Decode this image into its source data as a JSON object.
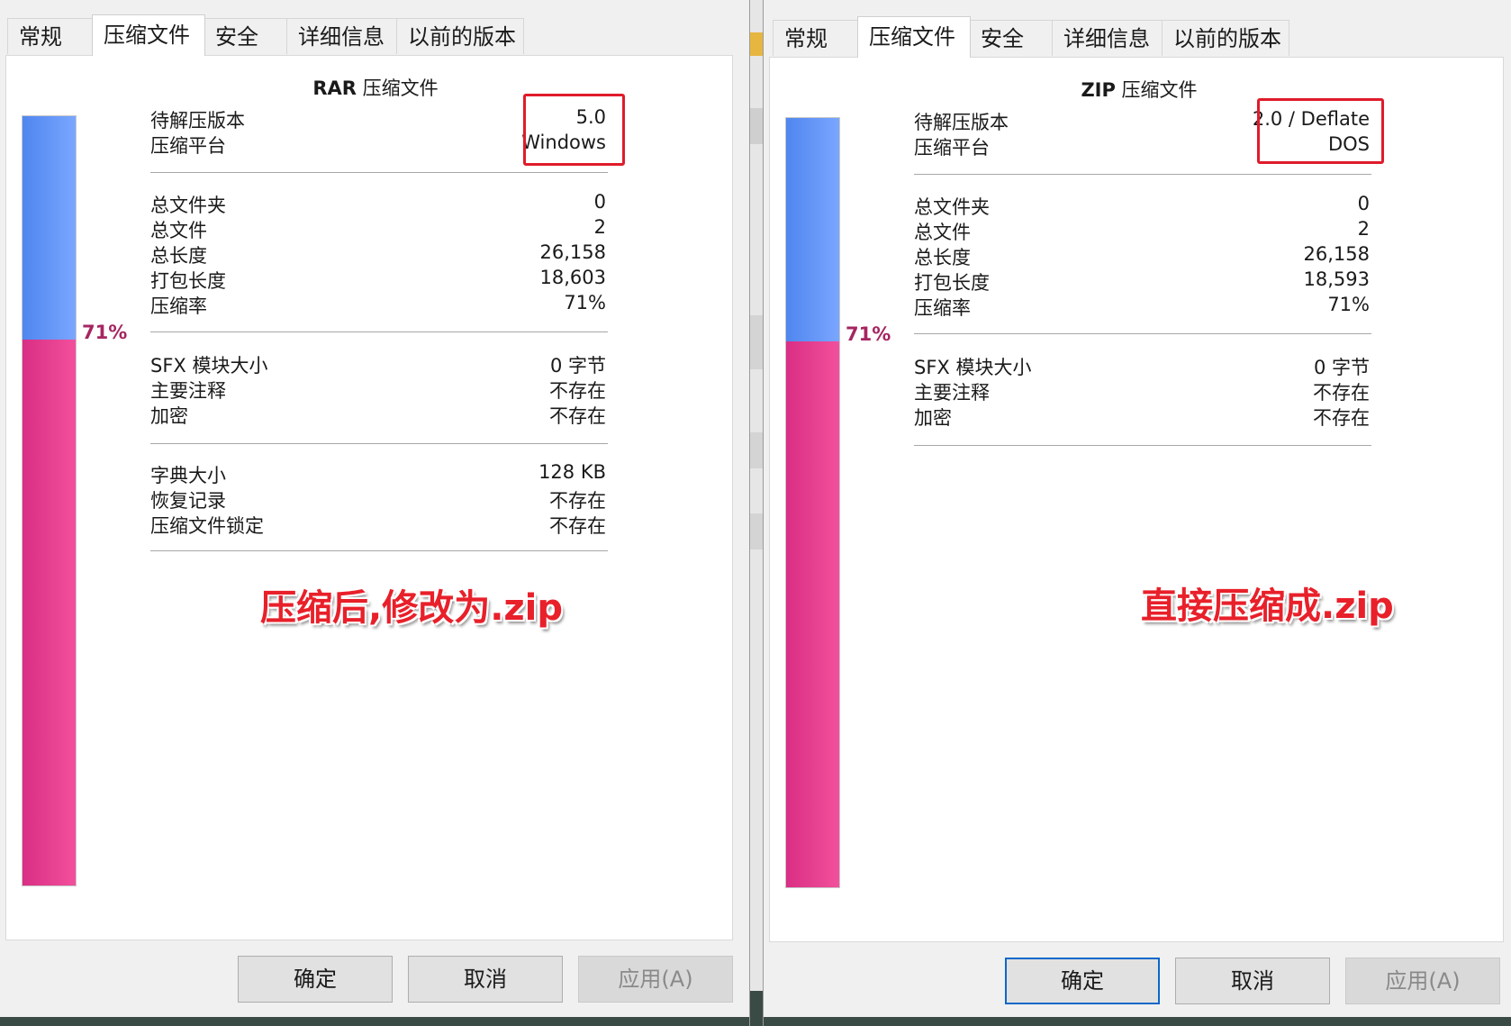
{
  "left": {
    "tabs": [
      "常规",
      "压缩文件",
      "安全",
      "详细信息",
      "以前的版本"
    ],
    "active_tab": 1,
    "heading_bold": "RAR",
    "heading_rest": " 压缩文件",
    "ratio_percent": 71,
    "ratio_label": "71%",
    "version_label": "待解压版本",
    "version_value": "5.0",
    "platform_label": "压缩平台",
    "platform_value": "Windows",
    "stats": [
      {
        "label": "总文件夹",
        "value": "0"
      },
      {
        "label": "总文件",
        "value": "2"
      },
      {
        "label": "总长度",
        "value": "26,158"
      },
      {
        "label": "打包长度",
        "value": "18,603"
      },
      {
        "label": "压缩率",
        "value": "71%"
      }
    ],
    "extras": [
      {
        "label": "SFX 模块大小",
        "value": "0 字节"
      },
      {
        "label": "主要注释",
        "value": "不存在"
      },
      {
        "label": "加密",
        "value": "不存在"
      }
    ],
    "extras2": [
      {
        "label": "字典大小",
        "value": "128 KB"
      },
      {
        "label": "恢复记录",
        "value": "不存在"
      },
      {
        "label": "压缩文件锁定",
        "value": "不存在"
      }
    ],
    "annotation": "压缩后,修改为.zip",
    "buttons": {
      "ok": "确定",
      "cancel": "取消",
      "apply": "应用(A)"
    }
  },
  "right": {
    "tabs": [
      "常规",
      "压缩文件",
      "安全",
      "详细信息",
      "以前的版本"
    ],
    "active_tab": 1,
    "heading_bold": "ZIP",
    "heading_rest": " 压缩文件",
    "ratio_percent": 71,
    "ratio_label": "71%",
    "version_label": "待解压版本",
    "version_value": "2.0 / Deflate",
    "platform_label": "压缩平台",
    "platform_value": "DOS",
    "stats": [
      {
        "label": "总文件夹",
        "value": "0"
      },
      {
        "label": "总文件",
        "value": "2"
      },
      {
        "label": "总长度",
        "value": "26,158"
      },
      {
        "label": "打包长度",
        "value": "18,593"
      },
      {
        "label": "压缩率",
        "value": "71%"
      }
    ],
    "extras": [
      {
        "label": "SFX 模块大小",
        "value": "0 字节"
      },
      {
        "label": "主要注释",
        "value": "不存在"
      },
      {
        "label": "加密",
        "value": "不存在"
      }
    ],
    "annotation": "直接压缩成.zip",
    "buttons": {
      "ok": "确定",
      "cancel": "取消",
      "apply": "应用(A)"
    }
  },
  "colors": {
    "bar_unused": "#4f86ef",
    "bar_used": "#e0388c",
    "percent_text": "#a62560",
    "highlight_box": "#e01b2a",
    "annotation": "#e8202a"
  }
}
